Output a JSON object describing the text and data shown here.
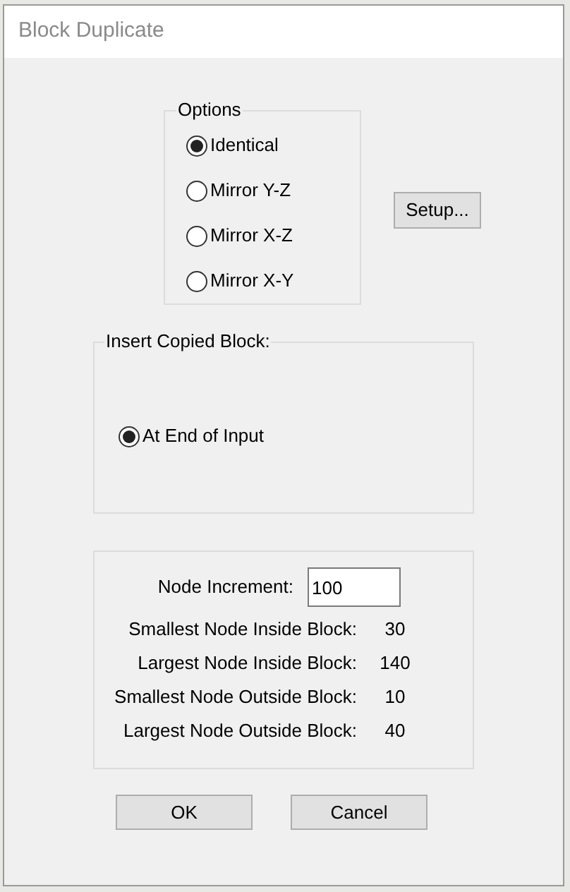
{
  "window": {
    "title": "Block Duplicate"
  },
  "options": {
    "title": "Options",
    "items": [
      {
        "label": "Identical",
        "selected": true
      },
      {
        "label": "Mirror Y-Z",
        "selected": false
      },
      {
        "label": "Mirror X-Z",
        "selected": false
      },
      {
        "label": "Mirror X-Y",
        "selected": false
      }
    ]
  },
  "setup_button": "Setup...",
  "insert_copied_block": {
    "title": "Insert Copied Block:",
    "items": [
      {
        "label": "At End of Input",
        "selected": true
      }
    ]
  },
  "node_info": {
    "increment_label": "Node Increment:",
    "increment_value": "100",
    "rows": [
      {
        "label": "Smallest Node Inside Block:",
        "value": "30"
      },
      {
        "label": "Largest Node Inside Block:",
        "value": "140"
      },
      {
        "label": "Smallest Node Outside Block:",
        "value": "10"
      },
      {
        "label": "Largest Node Outside Block:",
        "value": "40"
      }
    ]
  },
  "buttons": [
    "OK",
    "Cancel"
  ]
}
